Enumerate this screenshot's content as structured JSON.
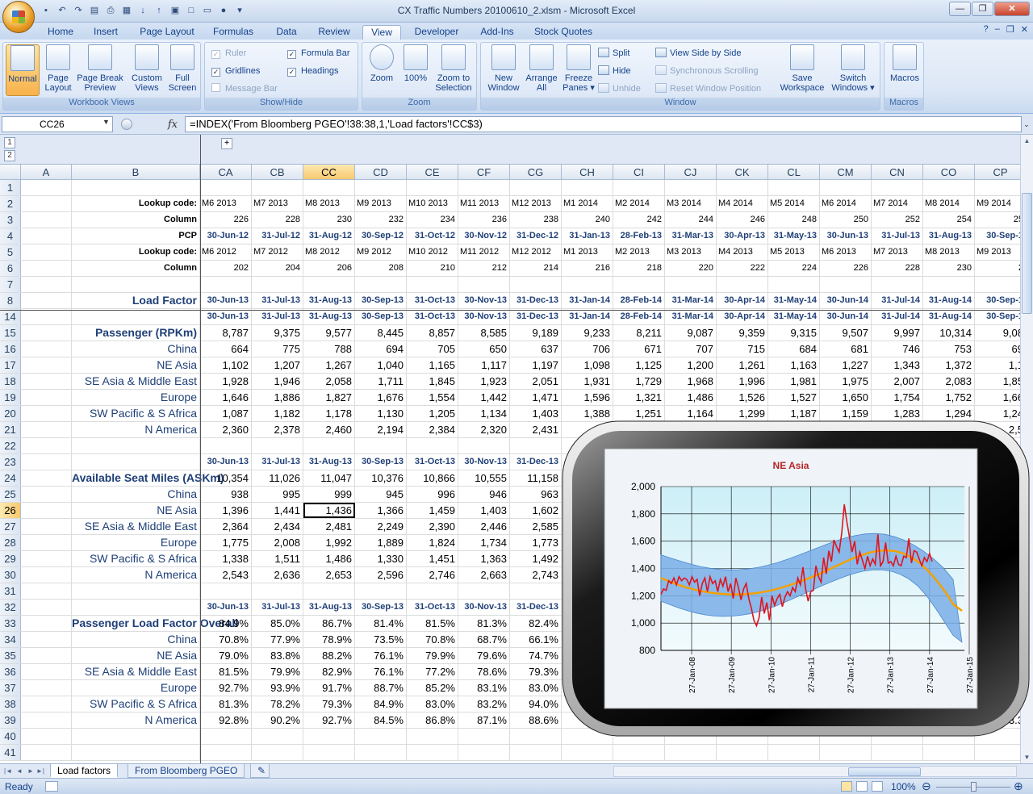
{
  "window": {
    "title": "CX Traffic Numbers 20100610_2.xlsm - Microsoft Excel"
  },
  "ribbon": {
    "tabs": [
      "Home",
      "Insert",
      "Page Layout",
      "Formulas",
      "Data",
      "Review",
      "View",
      "Developer",
      "Add-Ins",
      "Stock Quotes"
    ],
    "active_tab": "View",
    "groups": {
      "workbook_views": {
        "label": "Workbook Views",
        "normal": "Normal",
        "page_layout_1": "Page",
        "page_layout_2": "Layout",
        "page_break_1": "Page Break",
        "page_break_2": "Preview",
        "custom_1": "Custom",
        "custom_2": "Views",
        "full_1": "Full",
        "full_2": "Screen"
      },
      "show_hide": {
        "label": "Show/Hide",
        "ruler": "Ruler",
        "gridlines": "Gridlines",
        "message_bar": "Message Bar",
        "formula_bar": "Formula Bar",
        "headings": "Headings"
      },
      "zoom": {
        "label": "Zoom",
        "zoom": "Zoom",
        "hundred": "100%",
        "sel_1": "Zoom to",
        "sel_2": "Selection"
      },
      "window": {
        "label": "Window",
        "new_1": "New",
        "new_2": "Window",
        "arrange_1": "Arrange",
        "arrange_2": "All",
        "freeze_1": "Freeze",
        "freeze_2": "Panes",
        "split": "Split",
        "hide": "Hide",
        "unhide": "Unhide",
        "side_by_side": "View Side by Side",
        "sync": "Synchronous Scrolling",
        "reset": "Reset Window Position",
        "save_1": "Save",
        "save_2": "Workspace",
        "switch_1": "Switch",
        "switch_2": "Windows"
      },
      "macros": {
        "label": "Macros",
        "macros": "Macros"
      }
    }
  },
  "formula_bar": {
    "name_box": "CC26",
    "fx": "fx",
    "formula": "=INDEX('From Bloomberg PGEO'!38:38,1,'Load factors'!CC$3)"
  },
  "outline": {
    "level1": "1",
    "level2": "2",
    "expand": "+"
  },
  "columns": [
    "A",
    "B",
    "CA",
    "CB",
    "CC",
    "CD",
    "CE",
    "CF",
    "CG",
    "CH",
    "CI",
    "CJ",
    "CK",
    "CL",
    "CM",
    "CN",
    "CO",
    "CP"
  ],
  "selected_column": "CC",
  "selected_row": "26",
  "rows": [
    {
      "n": "1",
      "b": "",
      "style": "",
      "cells": []
    },
    {
      "n": "2",
      "b": "Lookup code:",
      "style": "sm",
      "cells": [
        "M6 2013",
        "M7 2013",
        "M8 2013",
        "M9 2013",
        "M10 2013",
        "M11 2013",
        "M12 2013",
        "M1 2014",
        "M2 2014",
        "M3 2014",
        "M4 2014",
        "M5 2014",
        "M6 2014",
        "M7 2014",
        "M8 2014",
        "M9 2014"
      ],
      "cell_align": "left"
    },
    {
      "n": "3",
      "b": "Column",
      "style": "sm",
      "cells": [
        "226",
        "228",
        "230",
        "232",
        "234",
        "236",
        "238",
        "240",
        "242",
        "244",
        "246",
        "248",
        "250",
        "252",
        "254",
        "25"
      ]
    },
    {
      "n": "4",
      "b": "PCP",
      "style": "sm",
      "cells": [
        "30-Jun-12",
        "31-Jul-12",
        "31-Aug-12",
        "30-Sep-12",
        "31-Oct-12",
        "30-Nov-12",
        "31-Dec-12",
        "31-Jan-13",
        "28-Feb-13",
        "31-Mar-13",
        "30-Apr-13",
        "31-May-13",
        "30-Jun-13",
        "31-Jul-13",
        "31-Aug-13",
        "30-Sep-1"
      ],
      "cell_style": "dh"
    },
    {
      "n": "5",
      "b": "Lookup code:",
      "style": "sm",
      "cells": [
        "M6 2012",
        "M7 2012",
        "M8 2012",
        "M9 2012",
        "M10 2012",
        "M11 2012",
        "M12 2012",
        "M1 2013",
        "M2 2013",
        "M3 2013",
        "M4 2013",
        "M5 2013",
        "M6 2013",
        "M7 2013",
        "M8 2013",
        "M9 2013"
      ],
      "cell_align": "left"
    },
    {
      "n": "6",
      "b": "Column",
      "style": "sm",
      "cells": [
        "202",
        "204",
        "206",
        "208",
        "210",
        "212",
        "214",
        "216",
        "218",
        "220",
        "222",
        "224",
        "226",
        "228",
        "230",
        "2"
      ]
    },
    {
      "n": "7",
      "b": "",
      "style": "",
      "cells": []
    },
    {
      "n": "8",
      "b": "Load Factor",
      "style": "big",
      "cells": [
        "30-Jun-13",
        "31-Jul-13",
        "31-Aug-13",
        "30-Sep-13",
        "31-Oct-13",
        "30-Nov-13",
        "31-Dec-13",
        "31-Jan-14",
        "28-Feb-14",
        "31-Mar-14",
        "30-Apr-14",
        "31-May-14",
        "30-Jun-14",
        "31-Jul-14",
        "31-Aug-14",
        "30-Sep-1"
      ],
      "cell_style": "dh"
    },
    {
      "n": "14",
      "b": "",
      "style": "",
      "cells": [
        "30-Jun-13",
        "31-Jul-13",
        "31-Aug-13",
        "30-Sep-13",
        "31-Oct-13",
        "30-Nov-13",
        "31-Dec-13",
        "31-Jan-14",
        "28-Feb-14",
        "31-Mar-14",
        "30-Apr-14",
        "31-May-14",
        "30-Jun-14",
        "31-Jul-14",
        "31-Aug-14",
        "30-Sep-1"
      ],
      "cell_style": "dh"
    },
    {
      "n": "15",
      "b": "Passenger (RPKm)",
      "style": "big",
      "cells": [
        "8,787",
        "9,375",
        "9,577",
        "8,445",
        "8,857",
        "8,585",
        "9,189",
        "9,233",
        "8,211",
        "9,087",
        "9,359",
        "9,315",
        "9,507",
        "9,997",
        "10,314",
        "9,08"
      ]
    },
    {
      "n": "16",
      "b": "China",
      "style": "",
      "cells": [
        "664",
        "775",
        "788",
        "694",
        "705",
        "650",
        "637",
        "706",
        "671",
        "707",
        "715",
        "684",
        "681",
        "746",
        "753",
        "69"
      ]
    },
    {
      "n": "17",
      "b": "NE Asia",
      "style": "",
      "cells": [
        "1,102",
        "1,207",
        "1,267",
        "1,040",
        "1,165",
        "1,117",
        "1,197",
        "1,098",
        "1,125",
        "1,200",
        "1,261",
        "1,163",
        "1,227",
        "1,343",
        "1,372",
        "1,1"
      ]
    },
    {
      "n": "18",
      "b": "SE Asia & Middle East",
      "style": "",
      "cells": [
        "1,928",
        "1,946",
        "2,058",
        "1,711",
        "1,845",
        "1,923",
        "2,051",
        "1,931",
        "1,729",
        "1,968",
        "1,996",
        "1,981",
        "1,975",
        "2,007",
        "2,083",
        "1,85"
      ]
    },
    {
      "n": "19",
      "b": "Europe",
      "style": "",
      "cells": [
        "1,646",
        "1,886",
        "1,827",
        "1,676",
        "1,554",
        "1,442",
        "1,471",
        "1,596",
        "1,321",
        "1,486",
        "1,526",
        "1,527",
        "1,650",
        "1,754",
        "1,752",
        "1,66"
      ]
    },
    {
      "n": "20",
      "b": "SW Pacific & S Africa",
      "style": "",
      "cells": [
        "1,087",
        "1,182",
        "1,178",
        "1,130",
        "1,205",
        "1,134",
        "1,403",
        "1,388",
        "1,251",
        "1,164",
        "1,299",
        "1,187",
        "1,159",
        "1,283",
        "1,294",
        "1,24"
      ]
    },
    {
      "n": "21",
      "b": "N America",
      "style": "",
      "cells": [
        "2,360",
        "2,378",
        "2,460",
        "2,194",
        "2,384",
        "2,320",
        "2,431",
        "",
        "",
        "",
        "",
        "",
        "",
        "",
        "",
        "2,5"
      ]
    },
    {
      "n": "22",
      "b": "",
      "style": "",
      "cells": []
    },
    {
      "n": "23",
      "b": "",
      "style": "",
      "cells": [
        "30-Jun-13",
        "31-Jul-13",
        "31-Aug-13",
        "30-Sep-13",
        "31-Oct-13",
        "30-Nov-13",
        "31-Dec-13"
      ],
      "cell_style": "dh"
    },
    {
      "n": "24",
      "b": "Available Seat Miles (ASKm)",
      "style": "big",
      "cells": [
        "10,354",
        "11,026",
        "11,047",
        "10,376",
        "10,866",
        "10,555",
        "11,158"
      ]
    },
    {
      "n": "25",
      "b": "China",
      "style": "",
      "cells": [
        "938",
        "995",
        "999",
        "945",
        "996",
        "946",
        "963"
      ]
    },
    {
      "n": "26",
      "b": "NE Asia",
      "style": "",
      "cells": [
        "1,396",
        "1,441",
        "1,436",
        "1,366",
        "1,459",
        "1,403",
        "1,602"
      ]
    },
    {
      "n": "27",
      "b": "SE Asia & Middle East",
      "style": "",
      "cells": [
        "2,364",
        "2,434",
        "2,481",
        "2,249",
        "2,390",
        "2,446",
        "2,585"
      ]
    },
    {
      "n": "28",
      "b": "Europe",
      "style": "",
      "cells": [
        "1,775",
        "2,008",
        "1,992",
        "1,889",
        "1,824",
        "1,734",
        "1,773"
      ]
    },
    {
      "n": "29",
      "b": "SW Pacific & S Africa",
      "style": "",
      "cells": [
        "1,338",
        "1,511",
        "1,486",
        "1,330",
        "1,451",
        "1,363",
        "1,492"
      ]
    },
    {
      "n": "30",
      "b": "N America",
      "style": "",
      "cells": [
        "2,543",
        "2,636",
        "2,653",
        "2,596",
        "2,746",
        "2,663",
        "2,743"
      ]
    },
    {
      "n": "31",
      "b": "",
      "style": "",
      "cells": []
    },
    {
      "n": "32",
      "b": "",
      "style": "",
      "cells": [
        "30-Jun-13",
        "31-Jul-13",
        "31-Aug-13",
        "30-Sep-13",
        "31-Oct-13",
        "30-Nov-13",
        "31-Dec-13"
      ],
      "cell_style": "dh"
    },
    {
      "n": "33",
      "b": "Passenger Load Factor Overall",
      "style": "big",
      "cells": [
        "84.9%",
        "85.0%",
        "86.7%",
        "81.4%",
        "81.5%",
        "81.3%",
        "82.4%"
      ]
    },
    {
      "n": "34",
      "b": "China",
      "style": "",
      "cells": [
        "70.8%",
        "77.9%",
        "78.9%",
        "73.5%",
        "70.8%",
        "68.7%",
        "66.1%"
      ]
    },
    {
      "n": "35",
      "b": "NE Asia",
      "style": "",
      "cells": [
        "79.0%",
        "83.8%",
        "88.2%",
        "76.1%",
        "79.9%",
        "79.6%",
        "74.7%"
      ]
    },
    {
      "n": "36",
      "b": "SE Asia & Middle East",
      "style": "",
      "cells": [
        "81.5%",
        "79.9%",
        "82.9%",
        "76.1%",
        "77.2%",
        "78.6%",
        "79.3%"
      ]
    },
    {
      "n": "37",
      "b": "Europe",
      "style": "",
      "cells": [
        "92.7%",
        "93.9%",
        "91.7%",
        "88.7%",
        "85.2%",
        "83.1%",
        "83.0%"
      ]
    },
    {
      "n": "38",
      "b": "SW Pacific & S Africa",
      "style": "",
      "cells": [
        "81.3%",
        "78.2%",
        "79.3%",
        "84.9%",
        "83.0%",
        "83.2%",
        "94.0%",
        "",
        "",
        "",
        "",
        "",
        "",
        "",
        "",
        "9"
      ]
    },
    {
      "n": "39",
      "b": "N America",
      "style": "",
      "cells": [
        "92.8%",
        "90.2%",
        "92.7%",
        "84.5%",
        "86.8%",
        "87.1%",
        "88.6%",
        "",
        "",
        "",
        "",
        "",
        "",
        "",
        "",
        "3.3"
      ]
    },
    {
      "n": "40",
      "b": "",
      "style": "",
      "cells": []
    },
    {
      "n": "41",
      "b": "",
      "style": "",
      "cells": []
    }
  ],
  "sheet_tabs": [
    "Load factors",
    "From Bloomberg PGEO"
  ],
  "active_sheet": "Load factors",
  "status": {
    "ready": "Ready",
    "zoom": "100%"
  },
  "chart_data": {
    "type": "line",
    "title": "NE Asia",
    "x_ticks": [
      "27-Jan-08",
      "27-Jan-09",
      "27-Jan-10",
      "27-Jan-11",
      "27-Jan-12",
      "27-Jan-13",
      "27-Jan-14",
      "27-Jan-15"
    ],
    "y_ticks": [
      "2,000",
      "1,800",
      "1,600",
      "1,400",
      "1,200",
      "1,000",
      "800"
    ],
    "ylim": [
      800,
      2000
    ],
    "xlim": [
      "2007-09",
      "2015-05"
    ],
    "series": [
      {
        "kind": "line",
        "color": "#e0141e",
        "values": [
          1210,
          1250,
          1240,
          1310,
          1290,
          1330,
          1280,
          1340,
          1310,
          1330,
          1320,
          1280,
          1340,
          1300,
          1320,
          1200,
          1290,
          1330,
          1230,
          1340,
          1290,
          1310,
          1230,
          1320,
          1270,
          1340,
          1230,
          1290,
          1180,
          1330,
          1260,
          1170,
          1250,
          1290,
          1180,
          1110,
          1020,
          980,
          1040,
          1190,
          1070,
          1150,
          1020,
          1200,
          1130,
          1180,
          1210,
          1120,
          1190,
          1230,
          1200,
          1260,
          1230,
          1330,
          1280,
          1410,
          1250,
          1160,
          1230,
          1240,
          1420,
          1340,
          1300,
          1480,
          1360,
          1530,
          1450,
          1610,
          1560,
          1520,
          1660,
          1870,
          1740,
          1630,
          1520,
          1600,
          1430,
          1520,
          1460,
          1400,
          1490,
          1420,
          1470,
          1430,
          1650,
          1420,
          1450,
          1590,
          1440,
          1450,
          1420,
          1490,
          1430,
          1420,
          1490,
          1480,
          1620,
          1440,
          1530,
          1520,
          1470,
          1420,
          1480,
          1450,
          1510,
          1450
        ]
      },
      {
        "kind": "trend",
        "color": "#f5a000",
        "values": [
          1330,
          1305,
          1282,
          1262,
          1245,
          1232,
          1222,
          1215,
          1211,
          1210,
          1212,
          1217,
          1225,
          1237,
          1252,
          1270,
          1290,
          1312,
          1336,
          1362,
          1390,
          1419,
          1448,
          1475,
          1498,
          1517,
          1529,
          1533,
          1527,
          1510,
          1480,
          1437,
          1380,
          1310,
          1228,
          1135,
          1090
        ]
      },
      {
        "kind": "band_upper",
        "color": "#7aaee6",
        "values": [
          1500,
          1476,
          1454,
          1433,
          1415,
          1402,
          1393,
          1390,
          1391,
          1397,
          1408,
          1424,
          1444,
          1468,
          1494,
          1521,
          1549,
          1577,
          1603,
          1625,
          1642,
          1653,
          1656,
          1650,
          1633,
          1607,
          1570,
          1525,
          1470,
          1405,
          1320
        ]
      },
      {
        "kind": "band_lower",
        "color": "#7aaee6",
        "values": [
          1160,
          1135,
          1111,
          1090,
          1073,
          1060,
          1052,
          1049,
          1051,
          1057,
          1068,
          1083,
          1103,
          1126,
          1153,
          1181,
          1210,
          1239,
          1268,
          1296,
          1322,
          1346,
          1367,
          1382,
          1390,
          1390,
          1380,
          1358,
          1323,
          1273,
          1200,
          1110,
          1010,
          910,
          860
        ]
      }
    ]
  }
}
